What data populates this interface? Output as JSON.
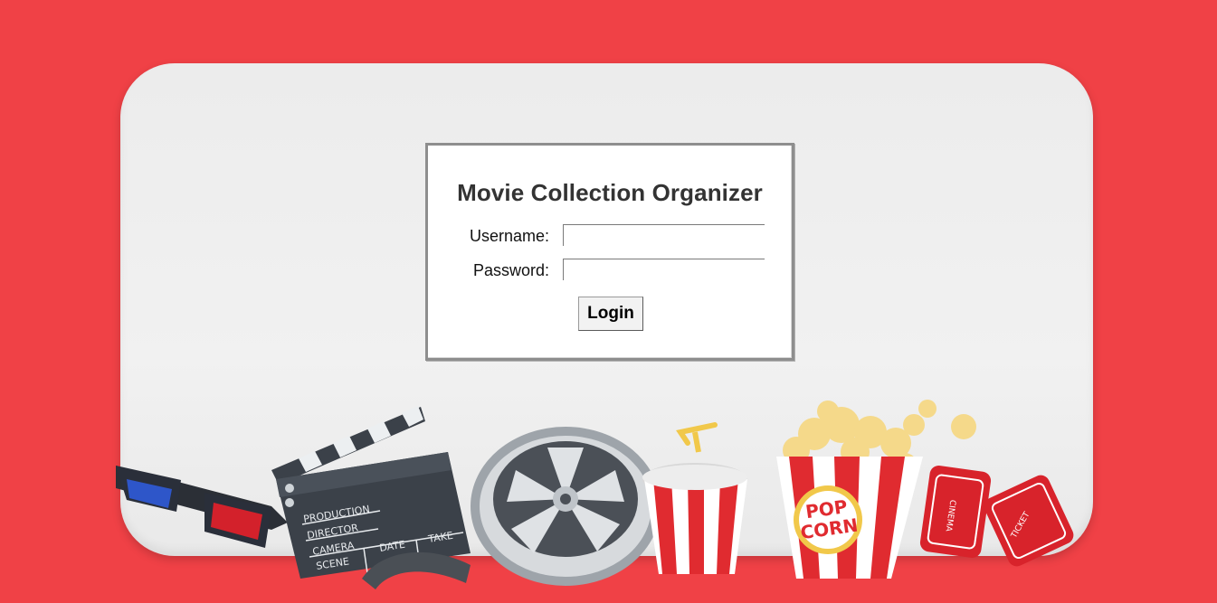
{
  "app": {
    "title": "Movie Collection Organizer"
  },
  "form": {
    "username_label": "Username:",
    "username_value": "",
    "password_label": "Password:",
    "password_value": "",
    "login_label": "Login"
  },
  "decor": {
    "clapperboard_lines": [
      "PRODUCTION",
      "DIRECTOR",
      "CAMERA",
      "DATE",
      "TAKE",
      "SCENE"
    ],
    "popcorn_text": [
      "POP",
      "CORN"
    ],
    "ticket_text": [
      "CINEMA",
      "TICKET"
    ]
  },
  "colors": {
    "background": "#f04146",
    "board": "#ededed",
    "accent_red": "#e02b30"
  }
}
